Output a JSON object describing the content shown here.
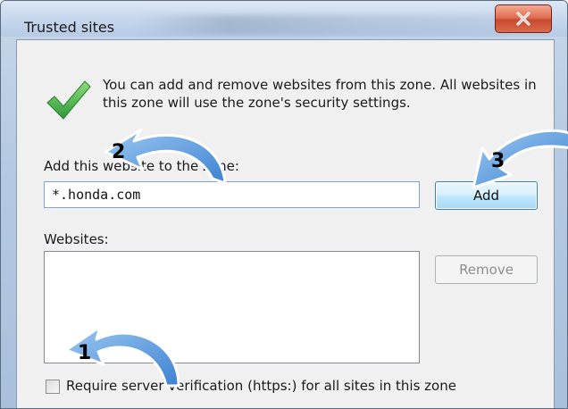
{
  "window": {
    "title": "Trusted sites",
    "close_glyph": "✕"
  },
  "info": {
    "icon": "green-checkmark-icon",
    "text": "You can add and remove websites from this zone. All websites in this zone will use the zone's security settings."
  },
  "add_site": {
    "label": "Add this website to the zone:",
    "input_value": "*.honda.com",
    "button_label": "Add"
  },
  "websites": {
    "label": "Websites:",
    "items": [],
    "remove_label": "Remove"
  },
  "https_option": {
    "label": "Require server verification (https:) for all sites in this zone",
    "checked": false
  },
  "annotations": {
    "step1": "1",
    "step2": "2",
    "step3": "3",
    "arrow_color": "#4a90d9"
  },
  "colors": {
    "accent": "#3c7fb1",
    "close_button": "#c84a2f",
    "check": "#3cb043"
  }
}
